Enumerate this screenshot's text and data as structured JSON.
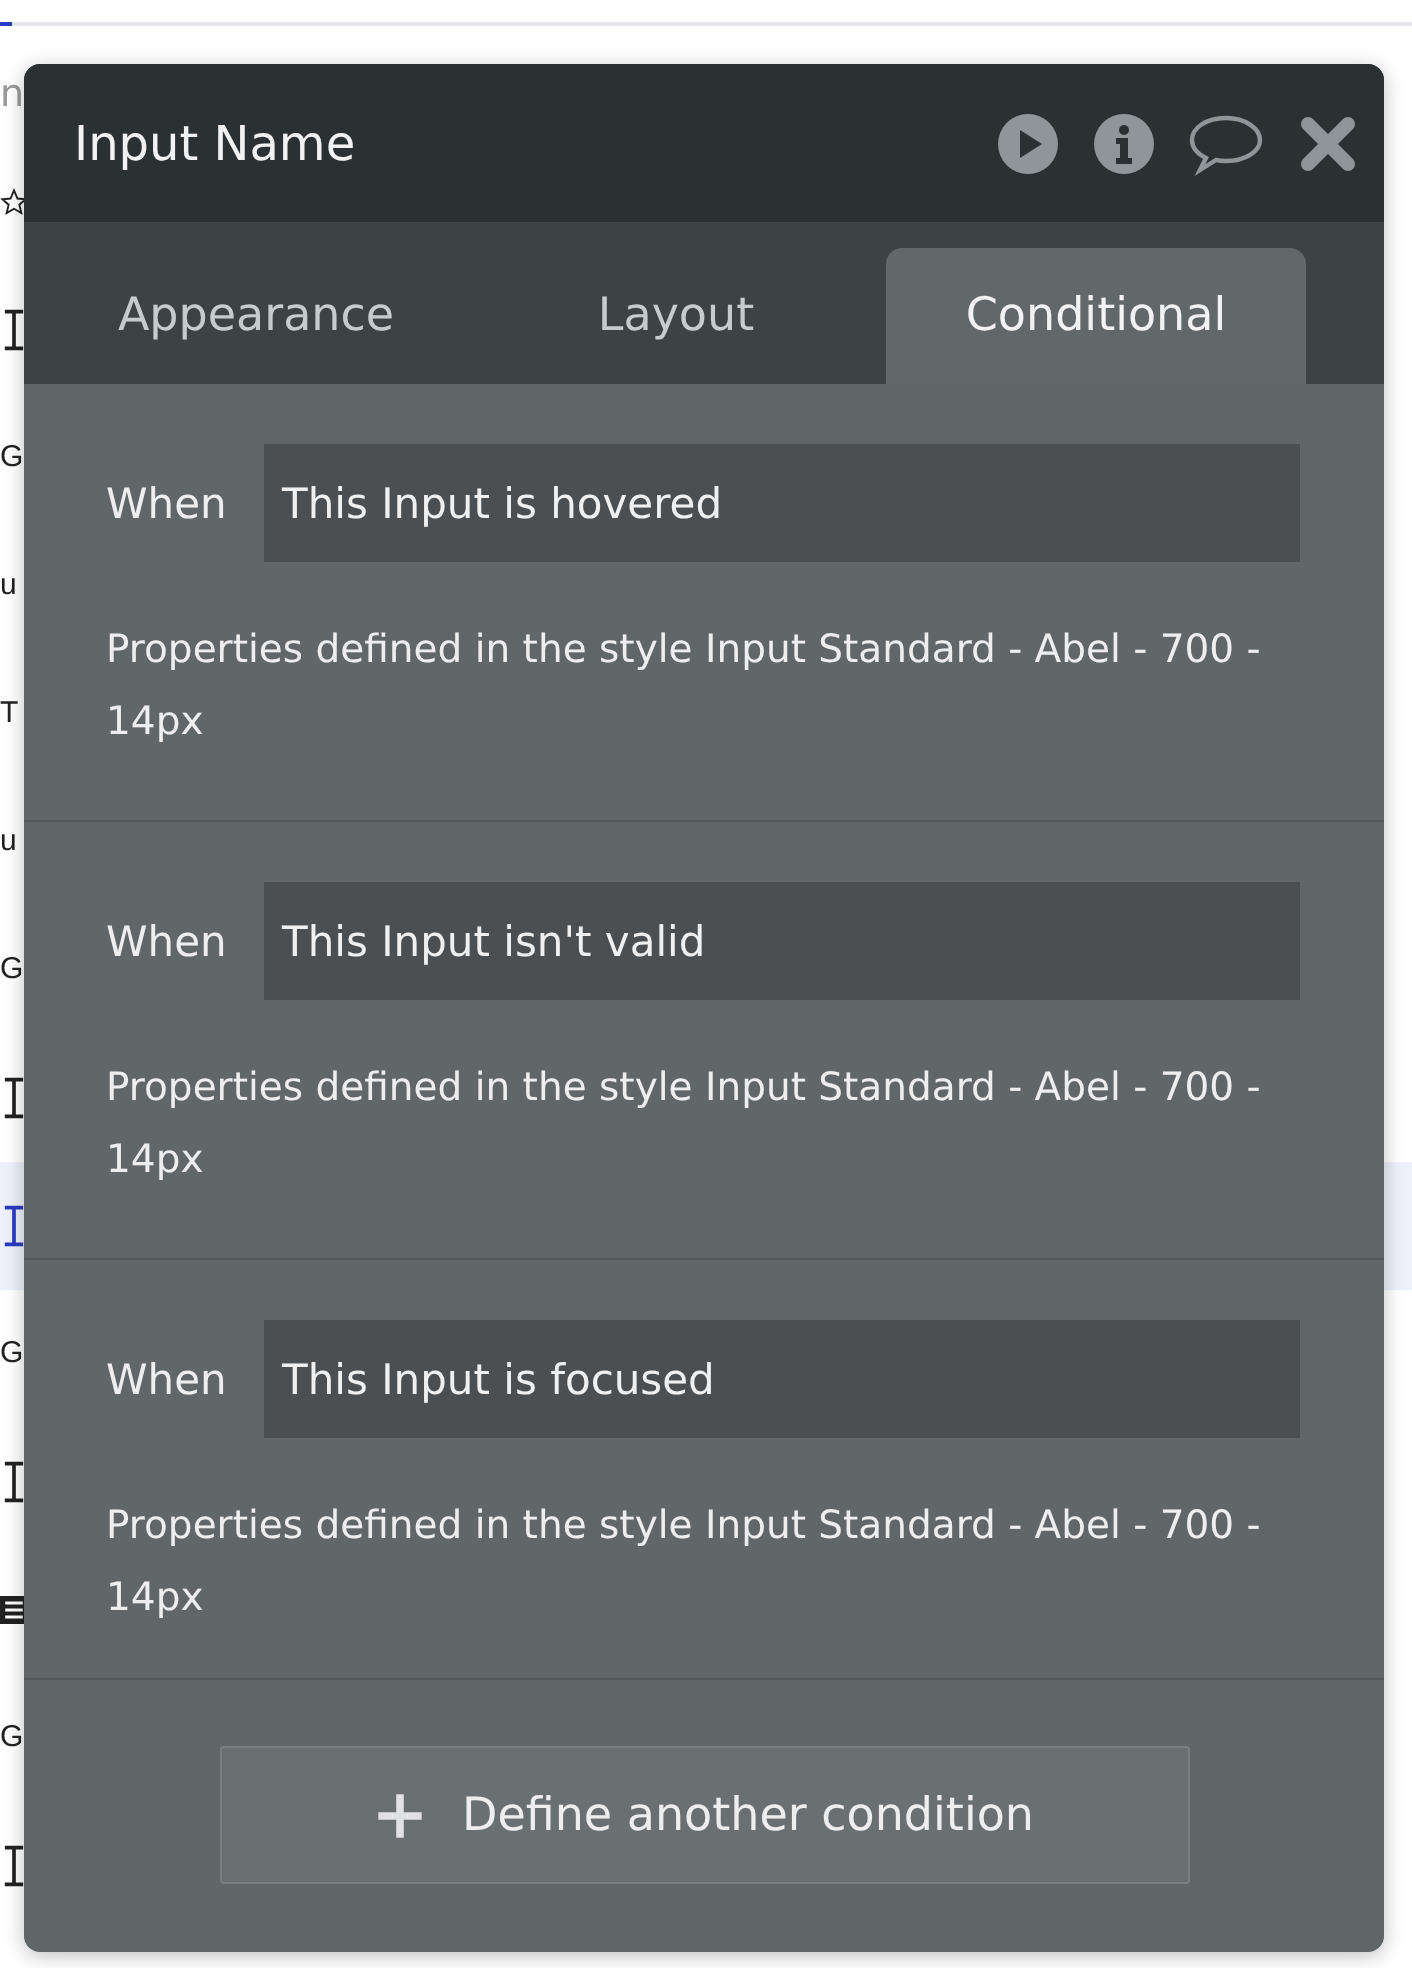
{
  "background_list": {
    "header_fragment": "n",
    "rows": [
      {
        "kind": "star",
        "text": ""
      },
      {
        "kind": "input",
        "text": ""
      },
      {
        "kind": "letter",
        "text": "G"
      },
      {
        "kind": "letter",
        "text": "u"
      },
      {
        "kind": "letter",
        "text": "T"
      },
      {
        "kind": "letter",
        "text": "u"
      },
      {
        "kind": "letter",
        "text": "G"
      },
      {
        "kind": "input",
        "text": ""
      },
      {
        "kind": "input",
        "text": "",
        "selected": true
      },
      {
        "kind": "letter",
        "text": "G"
      },
      {
        "kind": "input",
        "text": ""
      },
      {
        "kind": "list",
        "text": ""
      },
      {
        "kind": "letter",
        "text": "G"
      },
      {
        "kind": "input",
        "text": ""
      }
    ]
  },
  "panel": {
    "title": "Input Name",
    "tabs": [
      {
        "label": "Appearance",
        "selected": false
      },
      {
        "label": "Layout",
        "selected": false
      },
      {
        "label": "Conditional",
        "selected": true
      }
    ],
    "conditions": [
      {
        "when_label": "When",
        "expression": "This Input is hovered",
        "description": "Properties defined in the style Input Standard - Abel - 700 - 14px"
      },
      {
        "when_label": "When",
        "expression": "This Input isn't valid",
        "description": "Properties defined in the style Input Standard - Abel - 700 - 14px"
      },
      {
        "when_label": "When",
        "expression": "This Input is focused",
        "description": "Properties defined in the style Input Standard - Abel - 700 - 14px"
      }
    ],
    "add_button": "Define another condition"
  }
}
